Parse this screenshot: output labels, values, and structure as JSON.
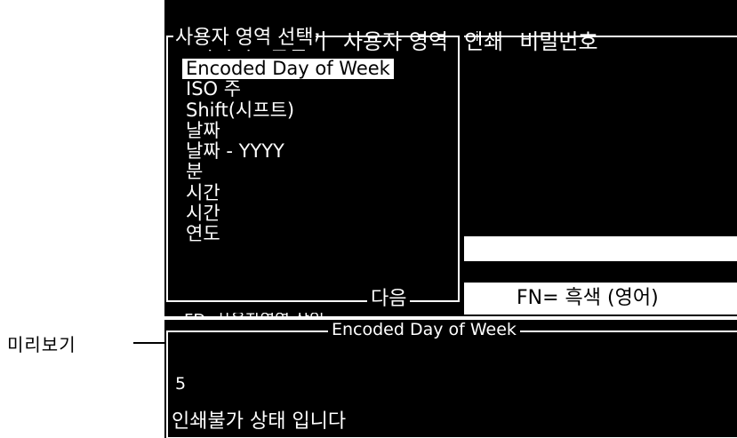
{
  "callout": {
    "label": "미리보기"
  },
  "menu": [
    "메시지",
    "편집기",
    "사용자 영역",
    "인쇄",
    "비밀번호"
  ],
  "dropdown": {
    "title": "사용자 영역 선택",
    "footer": "다음",
    "options": [
      "Encoded Day of Week",
      "ISO 주",
      "Shift(시프트)",
      "날짜",
      "날짜 - YYYY",
      "분",
      "시간",
      "시간",
      "연도"
    ],
    "selected_index": 0
  },
  "background": {
    "fn_hint": "FN= 흑색 (영어)"
  },
  "preview": {
    "title": "Encoded Day of Week",
    "value": "5",
    "status": "인쇄불가 상태 입니다"
  },
  "colors": {
    "screen_bg": "#000000",
    "screen_fg": "#ffffff",
    "highlight": "#ffffff"
  }
}
